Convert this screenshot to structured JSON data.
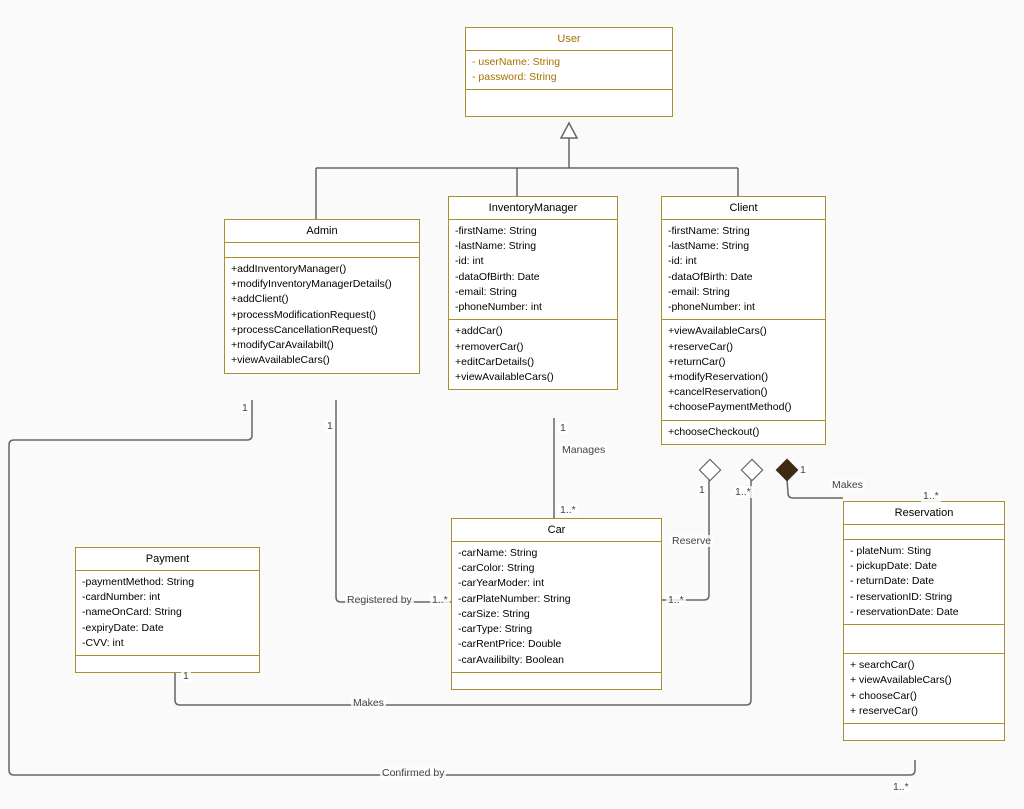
{
  "classes": {
    "user": {
      "name": "User",
      "attrs": [
        "- userName: String",
        "- password: String"
      ]
    },
    "admin": {
      "name": "Admin",
      "methods": [
        "+addInventoryManager()",
        "+modifyInventoryManagerDetails()",
        "+addClient()",
        "+processModificationRequest()",
        "+processCancellationRequest()",
        "+modifyCarAvailabilt()",
        "+viewAvailableCars()"
      ]
    },
    "invmgr": {
      "name": "InventoryManager",
      "attrs": [
        "-firstName: String",
        "-lastName: String",
        "-id: int",
        "-dataOfBirth: Date",
        "-email: String",
        "-phoneNumber: int"
      ],
      "methods": [
        "+addCar()",
        "+removerCar()",
        "+editCarDetails()",
        "+viewAvailableCars()"
      ]
    },
    "client": {
      "name": "Client",
      "attrs": [
        "-firstName: String",
        "-lastName: String",
        "-id: int",
        "-dataOfBirth: Date",
        "-email: String",
        "-phoneNumber: int"
      ],
      "methods": [
        "+viewAvailableCars()",
        "+reserveCar()",
        "+returnCar()",
        "+modifyReservation()",
        "+cancelReservation()",
        "+choosePaymentMethod()"
      ],
      "methods2": [
        "+chooseCheckout()"
      ]
    },
    "car": {
      "name": "Car",
      "attrs": [
        "-carName: String",
        "-carColor: String",
        "-carYearModer: int",
        "-carPlateNumber: String",
        "-carSize: String",
        "-carType: String",
        "-carRentPrice: Double",
        "-carAvailibilty: Boolean"
      ]
    },
    "payment": {
      "name": "Payment",
      "attrs": [
        "-paymentMethod: String",
        "-cardNumber: int",
        "-nameOnCard: String",
        "-expiryDate: Date",
        "-CVV: int"
      ]
    },
    "reservation": {
      "name": "Reservation",
      "attrs": [
        "- plateNum: Sting",
        "- pickupDate: Date",
        "- returnDate: Date",
        "- reservationID: String",
        "- reservationDate: Date"
      ],
      "methods": [
        "+ searchCar()",
        "+ viewAvailableCars()",
        "+ chooseCar()",
        "+ reserveCar()"
      ]
    }
  },
  "labels": {
    "manages": "Manages",
    "registered_by": "Registered by",
    "reserve": "Reserve",
    "makes1": "Makes",
    "makes2": "Makes",
    "confirmed_by": "Confirmed by"
  },
  "mult": {
    "admin_bottom_left": "1",
    "admin_bottom_right": "1",
    "invmgr_bottom": "1",
    "car_top": "1..*",
    "car_left": "1..*",
    "car_right": "1..*",
    "client_bottom_left": "1",
    "client_bottom_hollow": "1..*",
    "client_bottom_filled": "1",
    "reservation_top": "1..*",
    "reservation_bottom": "1..*",
    "payment_bottom": "1"
  }
}
